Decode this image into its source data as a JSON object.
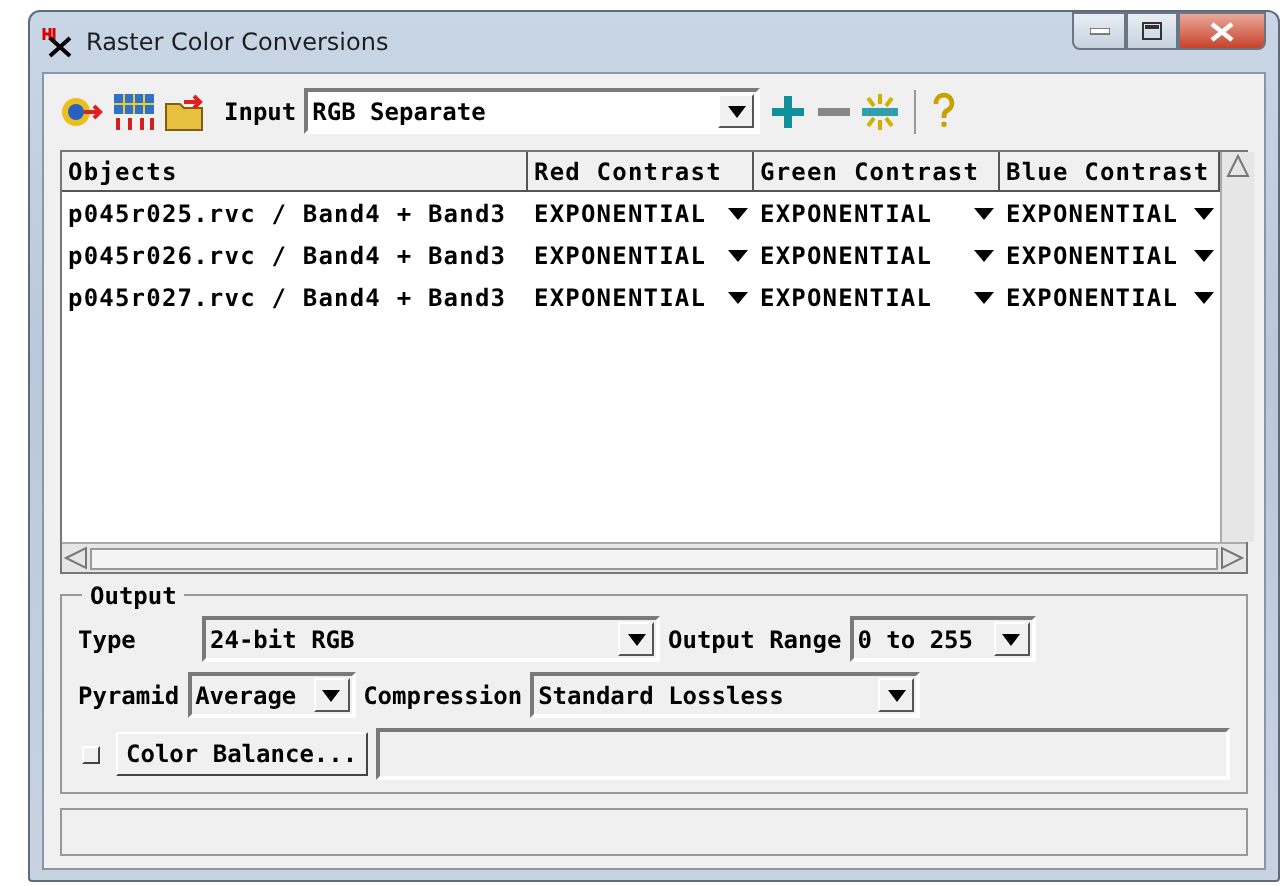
{
  "window": {
    "title": "Raster Color Conversions"
  },
  "toolbar": {
    "input_label": "Input",
    "input_value": "RGB Separate"
  },
  "table": {
    "columns": [
      "Objects",
      "Red Contrast",
      "Green Contrast",
      "Blue Contrast"
    ],
    "rows": [
      {
        "cells": [
          "p045r025.rvc / Band4 + Band3",
          "EXPONENTIAL",
          "EXPONENTIAL",
          "EXPONENTIAL"
        ]
      },
      {
        "cells": [
          "p045r026.rvc / Band4 + Band3",
          "EXPONENTIAL",
          "EXPONENTIAL",
          "EXPONENTIAL"
        ]
      },
      {
        "cells": [
          "p045r027.rvc / Band4 + Band3",
          "EXPONENTIAL",
          "EXPONENTIAL",
          "EXPONENTIAL"
        ]
      }
    ]
  },
  "output": {
    "title": "Output",
    "type_label": "Type",
    "type_value": "24-bit RGB",
    "range_label": "Output Range",
    "range_value": "0 to 255",
    "pyramid_label": "Pyramid",
    "pyramid_value": "Average",
    "compression_label": "Compression",
    "compression_value": "Standard Lossless",
    "color_balance": {
      "label": "Color Balance...",
      "checked": false
    }
  }
}
